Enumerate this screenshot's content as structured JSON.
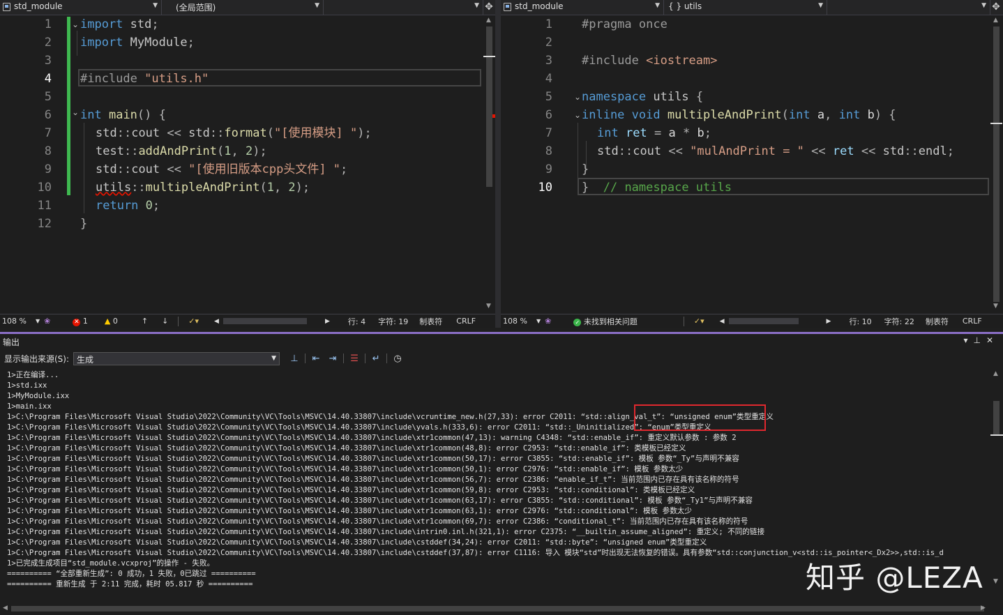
{
  "left_editor": {
    "nav": {
      "file": "std_module",
      "scope": "(全局范围)",
      "member": ""
    },
    "lines": [
      "1",
      "2",
      "3",
      "4",
      "5",
      "6",
      "7",
      "8",
      "9",
      "10",
      "11",
      "12"
    ],
    "current_line": "4",
    "status": {
      "zoom": "108 %",
      "errors": "1",
      "warnings": "0",
      "line": "行: 4",
      "col": "字符: 19",
      "tabs": "制表符",
      "eol": "CRLF"
    }
  },
  "right_editor": {
    "nav": {
      "file": "std_module",
      "scope": "{ } utils",
      "member": ""
    },
    "lines": [
      "1",
      "2",
      "3",
      "4",
      "5",
      "6",
      "7",
      "8",
      "9",
      "10"
    ],
    "current_line": "10",
    "status": {
      "zoom": "108 %",
      "issues": "未找到相关问题",
      "line": "行: 10",
      "col": "字符: 22",
      "tabs": "制表符",
      "eol": "CRLF"
    }
  },
  "output": {
    "title": "输出",
    "source_label": "显示输出来源(S):",
    "source_value": "生成",
    "lines": [
      "1>正在编译...",
      "1>std.ixx",
      "1>MyModule.ixx",
      "1>main.ixx",
      "1>C:\\Program Files\\Microsoft Visual Studio\\2022\\Community\\VC\\Tools\\MSVC\\14.40.33807\\include\\vcruntime_new.h(27,33): error C2011: “std::align_val_t”: “unsigned enum”类型重定义",
      "1>C:\\Program Files\\Microsoft Visual Studio\\2022\\Community\\VC\\Tools\\MSVC\\14.40.33807\\include\\yvals.h(333,6): error C2011: “std::_Uninitialized”: “enum”类型重定义",
      "1>C:\\Program Files\\Microsoft Visual Studio\\2022\\Community\\VC\\Tools\\MSVC\\14.40.33807\\include\\xtr1common(47,13): warning C4348: “std::enable_if”: 重定义默认参数 : 参数 2",
      "1>C:\\Program Files\\Microsoft Visual Studio\\2022\\Community\\VC\\Tools\\MSVC\\14.40.33807\\include\\xtr1common(48,8): error C2953: “std::enable_if”: 类模板已经定义",
      "1>C:\\Program Files\\Microsoft Visual Studio\\2022\\Community\\VC\\Tools\\MSVC\\14.40.33807\\include\\xtr1common(50,17): error C3855: “std::enable_if”: 模板 参数“_Ty”与声明不兼容",
      "1>C:\\Program Files\\Microsoft Visual Studio\\2022\\Community\\VC\\Tools\\MSVC\\14.40.33807\\include\\xtr1common(50,1): error C2976: “std::enable_if”: 模板 参数太少",
      "1>C:\\Program Files\\Microsoft Visual Studio\\2022\\Community\\VC\\Tools\\MSVC\\14.40.33807\\include\\xtr1common(56,7): error C2386: “enable_if_t”: 当前范围内已存在具有该名称的符号",
      "1>C:\\Program Files\\Microsoft Visual Studio\\2022\\Community\\VC\\Tools\\MSVC\\14.40.33807\\include\\xtr1common(59,8): error C2953: “std::conditional”: 类模板已经定义",
      "1>C:\\Program Files\\Microsoft Visual Studio\\2022\\Community\\VC\\Tools\\MSVC\\14.40.33807\\include\\xtr1common(63,17): error C3855: “std::conditional”: 模板 参数“_Ty1”与声明不兼容",
      "1>C:\\Program Files\\Microsoft Visual Studio\\2022\\Community\\VC\\Tools\\MSVC\\14.40.33807\\include\\xtr1common(63,1): error C2976: “std::conditional”: 模板 参数太少",
      "1>C:\\Program Files\\Microsoft Visual Studio\\2022\\Community\\VC\\Tools\\MSVC\\14.40.33807\\include\\xtr1common(69,7): error C2386: “conditional_t”: 当前范围内已存在具有该名称的符号",
      "1>C:\\Program Files\\Microsoft Visual Studio\\2022\\Community\\VC\\Tools\\MSVC\\14.40.33807\\include\\intrin0.inl.h(321,1): error C2375: “__builtin_assume_aligned”: 重定义; 不同的链接",
      "1>C:\\Program Files\\Microsoft Visual Studio\\2022\\Community\\VC\\Tools\\MSVC\\14.40.33807\\include\\cstddef(34,24): error C2011: “std::byte”: “unsigned enum”类型重定义",
      "1>C:\\Program Files\\Microsoft Visual Studio\\2022\\Community\\VC\\Tools\\MSVC\\14.40.33807\\include\\cstddef(37,87): error C1116: 导入 模块“std”时出现无法恢复的错误。具有参数“std::conjunction_v<std::is_pointer<_Dx2>>,std::is_d",
      "1>已完成生成项目“std_module.vcxproj”的操作 - 失败。",
      "========== “全部重新生成”: 0 成功，1 失败，0已跳过 ==========",
      "========== 重新生成 于 2:11 完成，耗时 05.817 秒 =========="
    ]
  },
  "watermark": "知乎 @LEZA"
}
